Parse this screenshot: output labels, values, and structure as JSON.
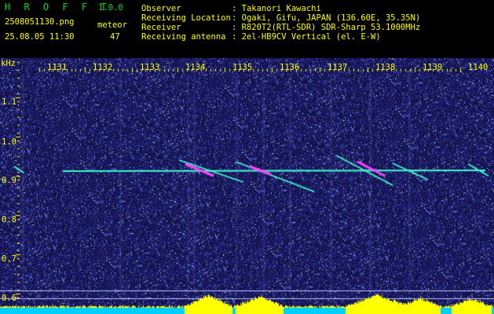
{
  "header": {
    "app_title": "H R O F F T",
    "version": "1.0.0",
    "filename": "2508051130.png",
    "datetime": "25.08.05 11:30",
    "meteor_label": "meteor",
    "meteor_count": "47",
    "info_labels": [
      "Observer",
      "Receiving Location",
      "Receiver",
      "Receiving antenna"
    ],
    "info_values": [
      ": Takanori Kawachi",
      ": Ogaki, Gifu, JAPAN (136.60E, 35.35N)",
      ": R820T2(RTL-SDR) SDR-Sharp 53.1000MHz",
      ": 2el-HB9CV Vertical (el. E-W)"
    ]
  },
  "plot": {
    "y_unit": "kHz",
    "x_ticks": [
      "1131",
      "1132",
      "1133",
      "1134",
      "1135",
      "1136",
      "1137",
      "1138",
      "1139",
      "1140"
    ],
    "y_ticks": [
      "1.1",
      "1.0",
      "0.9",
      "0.8",
      "0.7",
      "0.6"
    ]
  },
  "colors": {
    "background": "#000000",
    "label_yellow": "#ffff00",
    "title_green": "#00e000",
    "noise_blue": "#1a1a9a",
    "signal_cyan": "#40ffd0",
    "meteor_magenta": "#ff40ff",
    "baseline_cyan": "#00d0ff",
    "power_yellow": "#ffff00"
  }
}
